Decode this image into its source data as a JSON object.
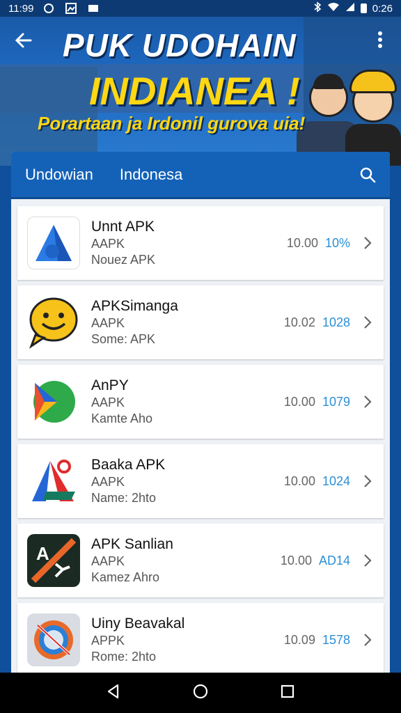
{
  "status_bar": {
    "time": "11:99",
    "battery_time": "0:26"
  },
  "banner": {
    "title": "PUK UDOHAIN",
    "subtitle": "INDIANEA !",
    "tagline": "Porartaan ja Irdonil gurova uia!"
  },
  "header": {
    "tabs": [
      "Undowian",
      "Indonesa"
    ]
  },
  "apps": [
    {
      "name": "Unnt APK",
      "type": "AAPK",
      "sub": "Nouez APK",
      "version": "10.00",
      "size": "10%",
      "icon": "blue-a-icon"
    },
    {
      "name": "APKSimanga",
      "type": "AAPK",
      "sub": "Some: APK",
      "version": "10.02",
      "size": "1028",
      "icon": "smiley-bubble-icon"
    },
    {
      "name": "AnPY",
      "type": "AAPK",
      "sub": "Kamte Aho",
      "version": "10.00",
      "size": "1079",
      "icon": "green-play-icon"
    },
    {
      "name": "Baaka APK",
      "type": "AAPK",
      "sub": "Name: 2hto",
      "version": "10.00",
      "size": "1024",
      "icon": "red-blue-a-icon"
    },
    {
      "name": "APK Sanlian",
      "type": "AAPK",
      "sub": "Kamez Ahro",
      "version": "10.00",
      "size": "AD14",
      "icon": "dark-a-slash-icon"
    },
    {
      "name": "Uiny Beavakal",
      "type": "APPK",
      "sub": "Rome: 2hto",
      "version": "10.09",
      "size": "1578",
      "icon": "compass-icon"
    }
  ],
  "colors": {
    "accent": "#1462b8",
    "size_text": "#2b8fd6",
    "banner_yellow": "#ffd713"
  }
}
